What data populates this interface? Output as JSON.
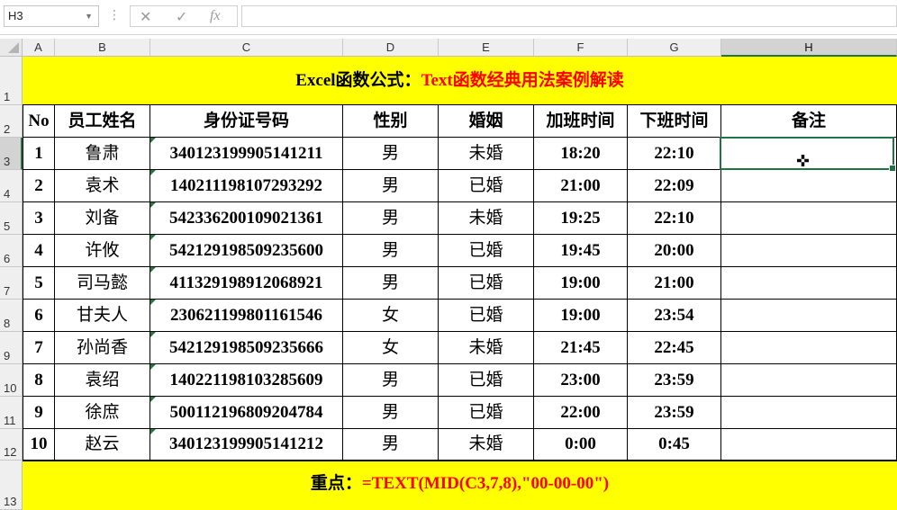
{
  "formula_bar": {
    "name_box": "H3",
    "formula": ""
  },
  "columns": [
    "A",
    "B",
    "C",
    "D",
    "E",
    "F",
    "G",
    "H"
  ],
  "selected_column": "H",
  "rows": [
    "1",
    "2",
    "3",
    "4",
    "5",
    "6",
    "7",
    "8",
    "9",
    "10",
    "11",
    "12",
    "13"
  ],
  "selected_row": "3",
  "title": {
    "black": "Excel函数公式：",
    "red": "Text函数经典用法案例解读"
  },
  "headers": [
    "No",
    "员工姓名",
    "身份证号码",
    "性别",
    "婚姻",
    "加班时间",
    "下班时间",
    "备注"
  ],
  "records": [
    [
      "1",
      "鲁肃",
      "340123199905141211",
      "男",
      "未婚",
      "18:20",
      "22:10",
      ""
    ],
    [
      "2",
      "袁术",
      "140211198107293292",
      "男",
      "已婚",
      "21:00",
      "22:09",
      ""
    ],
    [
      "3",
      "刘备",
      "542336200109021361",
      "男",
      "未婚",
      "19:25",
      "22:10",
      ""
    ],
    [
      "4",
      "许攸",
      "542129198509235600",
      "男",
      "已婚",
      "19:45",
      "20:00",
      ""
    ],
    [
      "5",
      "司马懿",
      "411329198912068921",
      "男",
      "已婚",
      "19:00",
      "21:00",
      ""
    ],
    [
      "6",
      "甘夫人",
      "230621199801161546",
      "女",
      "已婚",
      "19:00",
      "23:54",
      ""
    ],
    [
      "7",
      "孙尚香",
      "542129198509235666",
      "女",
      "未婚",
      "21:45",
      "22:45",
      ""
    ],
    [
      "8",
      "袁绍",
      "140221198103285609",
      "男",
      "已婚",
      "23:00",
      "23:59",
      ""
    ],
    [
      "9",
      "徐庶",
      "500112196809204784",
      "男",
      "已婚",
      "22:00",
      "23:59",
      ""
    ],
    [
      "10",
      "赵云",
      "340123199905141212",
      "男",
      "未婚",
      "0:00",
      "0:45",
      ""
    ]
  ],
  "footer": {
    "black": "重点：",
    "red": "=TEXT(MID(C3,7,8),\"00-00-00\")"
  }
}
